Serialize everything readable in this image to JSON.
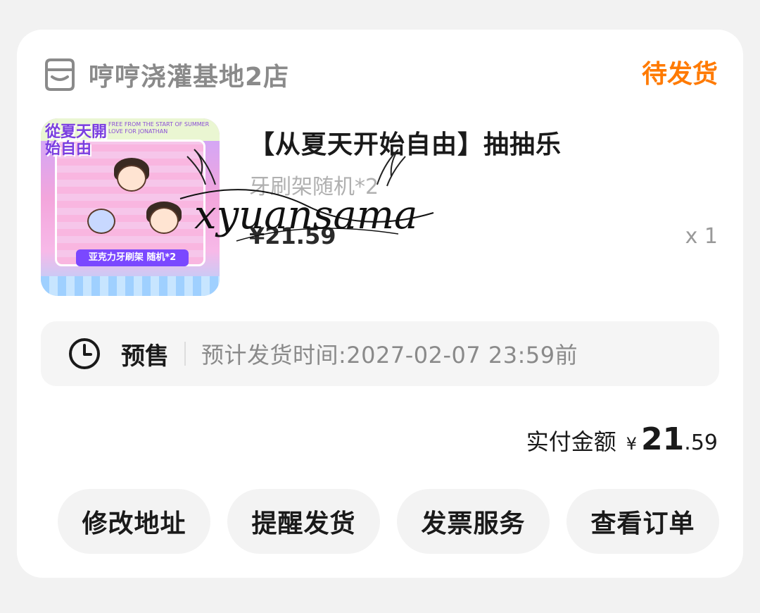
{
  "shop": {
    "name": "哼哼浇灌基地2店",
    "icon": "store-icon"
  },
  "order": {
    "status": "待发货",
    "status_color": "#ff7a00"
  },
  "product": {
    "title": "【从夏天开始自由】抽抽乐",
    "sku": "牙刷架随机*2",
    "price": "¥21.59",
    "quantity": "x 1",
    "thumbnail": {
      "header_text": "FREE FROM THE START OF SUMMER LOVE FOR JONATHAN",
      "title_text": "從夏天開始自由",
      "banner_text": "亚克力牙刷架 随机*2"
    }
  },
  "watermark": {
    "text": "xyuansama"
  },
  "presale": {
    "icon": "clock-icon",
    "label": "预售",
    "ship_time": "预计发货时间:2027-02-07 23:59前"
  },
  "payment": {
    "label": "实付金额",
    "currency": "¥",
    "amount_int": "21",
    "amount_dec": ".59"
  },
  "actions": [
    {
      "label": "修改地址"
    },
    {
      "label": "提醒发货"
    },
    {
      "label": "发票服务"
    },
    {
      "label": "查看订单"
    }
  ]
}
